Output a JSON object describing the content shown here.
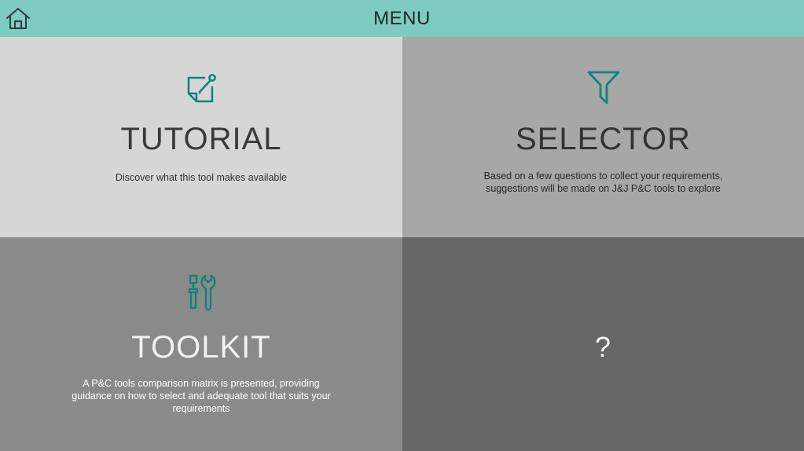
{
  "header": {
    "title": "MENU",
    "home_icon": "home-icon"
  },
  "colors": {
    "header_bg": "#7ecbc2",
    "accent": "#0f8577",
    "tile_tutorial_bg": "#d6d6d6",
    "tile_selector_bg": "#a7a7a7",
    "tile_toolkit_bg": "#8a8a8a",
    "tile_unknown_bg": "#666666"
  },
  "tiles": [
    {
      "title": "TUTORIAL",
      "icon": "note-pencil-icon",
      "description": "Discover what this tool makes available"
    },
    {
      "title": "SELECTOR",
      "icon": "filter-icon",
      "description": "Based on a few questions to collect your requirements, suggestions will be made on J&J P&C tools to explore"
    },
    {
      "title": "TOOLKIT",
      "icon": "tools-icon",
      "description": "A P&C tools comparison matrix is presented, providing guidance on how to select and adequate tool that suits your requirements"
    },
    {
      "title": "?",
      "icon": "",
      "description": ""
    }
  ]
}
